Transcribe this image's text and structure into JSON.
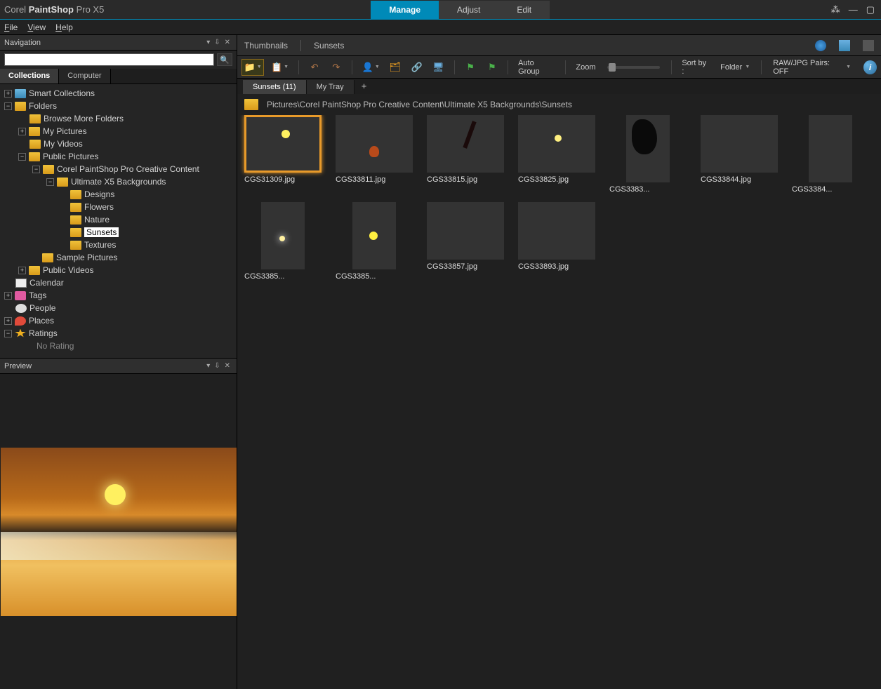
{
  "app": {
    "brand_light1": "Corel ",
    "brand_bold": "PaintShop",
    "brand_light2": " Pro X5"
  },
  "main_tabs": {
    "manage": "Manage",
    "adjust": "Adjust",
    "edit": "Edit"
  },
  "menu": {
    "file": "File",
    "view": "View",
    "help": "Help"
  },
  "nav_panel": {
    "title": "Navigation"
  },
  "coll_tabs": {
    "collections": "Collections",
    "computer": "Computer"
  },
  "tree": {
    "smart": "Smart Collections",
    "folders": "Folders",
    "browse_more": "Browse More Folders",
    "my_pictures": "My Pictures",
    "my_videos": "My Videos",
    "public_pictures": "Public Pictures",
    "psp_content": "Corel PaintShop Pro Creative Content",
    "ultimate_bg": "Ultimate X5 Backgrounds",
    "designs": "Designs",
    "flowers": "Flowers",
    "nature": "Nature",
    "sunsets": "Sunsets",
    "textures": "Textures",
    "sample_pictures": "Sample Pictures",
    "public_videos": "Public Videos",
    "calendar": "Calendar",
    "tags": "Tags",
    "people": "People",
    "places": "Places",
    "ratings": "Ratings",
    "no_rating": "No Rating"
  },
  "preview_panel": {
    "title": "Preview"
  },
  "breadcrumb": {
    "thumbnails": "Thumbnails",
    "sunsets": "Sunsets"
  },
  "toolbar": {
    "auto_group": "Auto Group",
    "zoom": "Zoom",
    "sort_by": "Sort by :",
    "folder": "Folder",
    "raw_jpg": "RAW/JPG Pairs: OFF"
  },
  "tray_tabs": {
    "sunsets": "Sunsets (11)",
    "my_tray": "My Tray"
  },
  "path": "Pictures\\Corel PaintShop Pro Creative Content\\Ultimate X5 Backgrounds\\Sunsets",
  "thumbs": [
    {
      "file": "CGS31309.jpg",
      "art": "art1",
      "sel": true
    },
    {
      "file": "CGS33811.jpg",
      "art": "art2"
    },
    {
      "file": "CGS33815.jpg",
      "art": "art3"
    },
    {
      "file": "CGS33825.jpg",
      "art": "art4"
    },
    {
      "file": "CGS3383...",
      "art": "art5",
      "tall": true
    },
    {
      "file": "CGS33844.jpg",
      "art": "art6"
    },
    {
      "file": "CGS3384...",
      "art": "art7",
      "tall": true
    },
    {
      "file": "CGS3385...",
      "art": "art8",
      "tall": true
    },
    {
      "file": "CGS3385...",
      "art": "art9",
      "tall": true
    },
    {
      "file": "CGS33857.jpg",
      "art": "art10"
    },
    {
      "file": "CGS33893.jpg",
      "art": "art11"
    }
  ]
}
